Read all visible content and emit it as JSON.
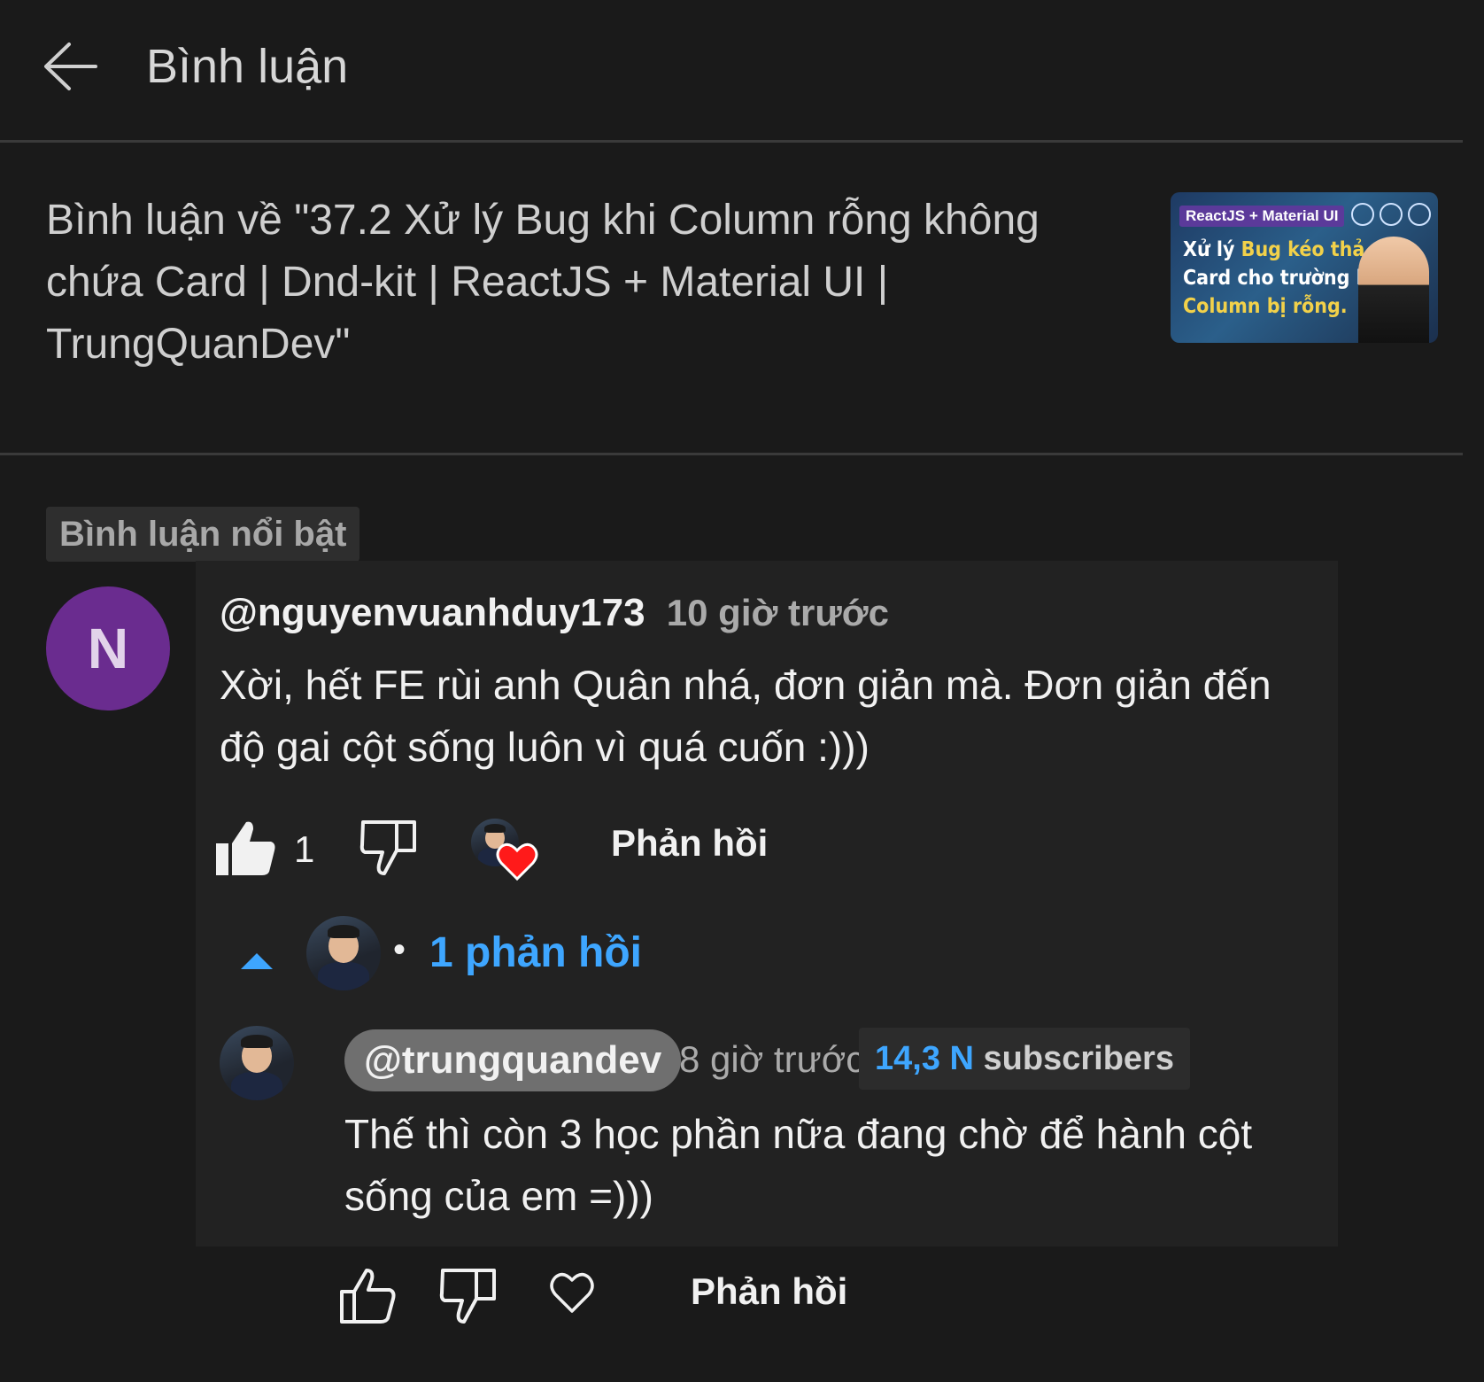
{
  "header": {
    "title": "Bình luận"
  },
  "video": {
    "title": "Bình luận về \"37.2 Xử lý Bug khi Column rỗng không chứa Card | Dnd-kit | ReactJS + Material UI | TrungQuanDev\"",
    "thumbnail": {
      "tag": "ReactJS + Material UI",
      "line1a": "Xử lý ",
      "line1b": "Bug kéo thả",
      "line2": "Card cho trường hợp",
      "line3": "Column bị rỗng."
    }
  },
  "highlighted_label": "Bình luận nổi bật",
  "comment": {
    "avatar_letter": "N",
    "author": "@nguyenvuanhduy173",
    "time": "10 giờ trước",
    "text": "Xời, hết FE rùi anh Quân nhá, đơn giản mà. Đơn giản đến độ gai cột sống luôn vì quá cuốn :)))",
    "likes": "1",
    "reply_label": "Phản hồi",
    "creator_hearted": true,
    "replies_dot": "•",
    "replies_label": "1 phản hồi"
  },
  "reply": {
    "author": "@trungquandev",
    "time": "8 giờ trước",
    "subscribers_count": "14,3 N",
    "subscribers_label": "subscribers",
    "text": "Thế thì còn 3 học phần nữa đang chờ để hành cột sống của em =)))",
    "reply_label": "Phản hồi"
  },
  "colors": {
    "background": "#1a1a1a",
    "link": "#3ea6ff",
    "heart": "#ff0000",
    "avatar": "#6a2c8f"
  }
}
